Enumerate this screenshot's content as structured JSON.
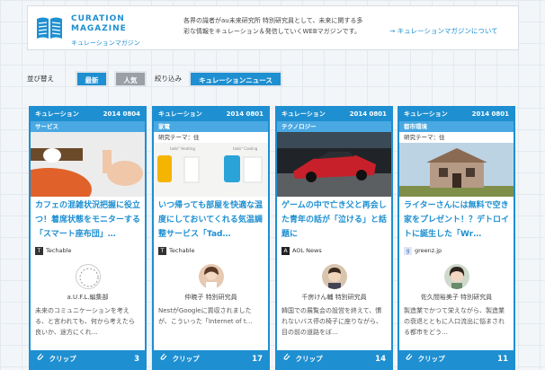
{
  "header": {
    "logo_line1": "CURATION",
    "logo_line2": "MAGAZINE",
    "logo_sub": "キュレーションマガジン",
    "description": "各界の識者がau未来研究所 特別研究員として、未来に関する多彩な情報をキュレーション＆発信していくWEBマガジンです。",
    "about_link": "→ キュレーションマガジンについて"
  },
  "filters": {
    "sort_label": "並び替え",
    "sort_new": "最新",
    "sort_popular": "人気",
    "narrow_label": "絞り込み",
    "narrow_value": "キュレーションニュース"
  },
  "cards": [
    {
      "type": "キュレーション",
      "date": "2014 0804",
      "category": "サービス",
      "theme": "",
      "title": "カフェの混雑状況把握に役立つ！着席状態をモニターする「スマート座布団」…",
      "source": "Techable",
      "source_icon": "T",
      "author": "a.U.F.L.編集部",
      "excerpt": "未来のコミュニケーションを考える、と言われても、何から考えたら良いか、途方にくれ…",
      "clip_label": "クリップ",
      "clip_count": "3"
    },
    {
      "type": "キュレーション",
      "date": "2014 0801",
      "category": "家電",
      "theme": "研究テーマ：住",
      "title": "いつ帰っても部屋を快適な温度にしておいてくれる気温調整サービス「Tad…",
      "source": "Techable",
      "source_icon": "T",
      "author": "仲暁子 特別研究員",
      "excerpt": "NestがGoogleに買収されましたが、こういった「Internet of t…",
      "clip_label": "クリップ",
      "clip_count": "17"
    },
    {
      "type": "キュレーション",
      "date": "2014 0801",
      "category": "テクノロジー",
      "theme": "",
      "title": "ゲームの中で亡き父と再会した青年の話が「泣ける」と話題に",
      "source": "AOL News",
      "source_icon": "A",
      "author": "千房けん輔 特別研究員",
      "excerpt": "韓国での展覧会の設営を終えて、慣れないバス停の椅子に座りながら、目の前の道路をぼ…",
      "clip_label": "クリップ",
      "clip_count": "14"
    },
    {
      "type": "キュレーション",
      "date": "2014 0801",
      "category": "都市環境",
      "theme": "研究テーマ：住",
      "title": "ライターさんには無料で空き家をプレゼント！？デトロイトに誕生した「Wr…",
      "source": "greenz.jp",
      "source_icon": "g",
      "author": "佐久間裕美子 特別研究員",
      "excerpt": "製造業でかつて栄えながら、製造業の衰退とともに人口流出に悩まされる都市をどう…",
      "clip_label": "クリップ",
      "clip_count": "11"
    }
  ],
  "colors": {
    "accent": "#1e8fd1",
    "category": "#4aa8e2",
    "chip_gray": "#9aa0a6"
  }
}
